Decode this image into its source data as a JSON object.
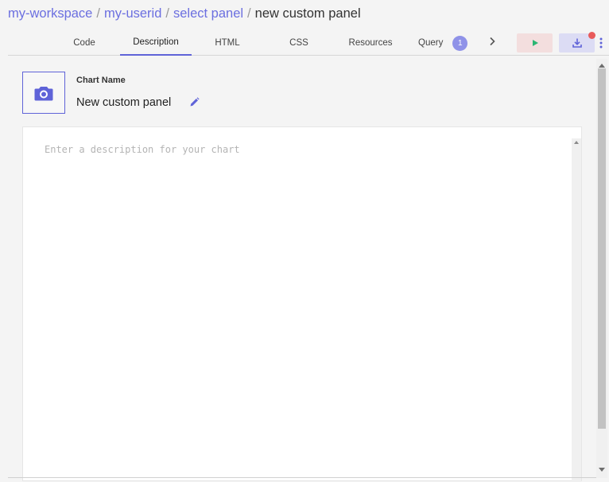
{
  "breadcrumb": {
    "items": [
      "my-workspace",
      "my-userid",
      "select panel"
    ],
    "separator": "/",
    "current": "new custom panel"
  },
  "tabs": [
    {
      "label": "Code"
    },
    {
      "label": "Description",
      "active": true
    },
    {
      "label": "HTML"
    },
    {
      "label": "CSS"
    },
    {
      "label": "Resources"
    },
    {
      "label": "Query",
      "badge": "1"
    }
  ],
  "toolbar": {
    "run_icon": "play-icon",
    "save_icon": "download-icon",
    "more_icon": "more-vertical-icon",
    "next_icon": "chevron-right-icon"
  },
  "chart": {
    "name_label": "Chart Name",
    "name": "New custom panel",
    "thumbnail_icon": "camera-icon",
    "edit_icon": "pencil-icon"
  },
  "editor": {
    "placeholder": "Enter a description for your chart"
  },
  "colors": {
    "accent": "#5f63d8",
    "link": "#6b6fe0",
    "badge": "#8f92e8",
    "run_button_bg": "#f3dede",
    "run_icon": "#2bb673",
    "save_button_bg": "#dcdcf4",
    "notification": "#e85a5a"
  }
}
